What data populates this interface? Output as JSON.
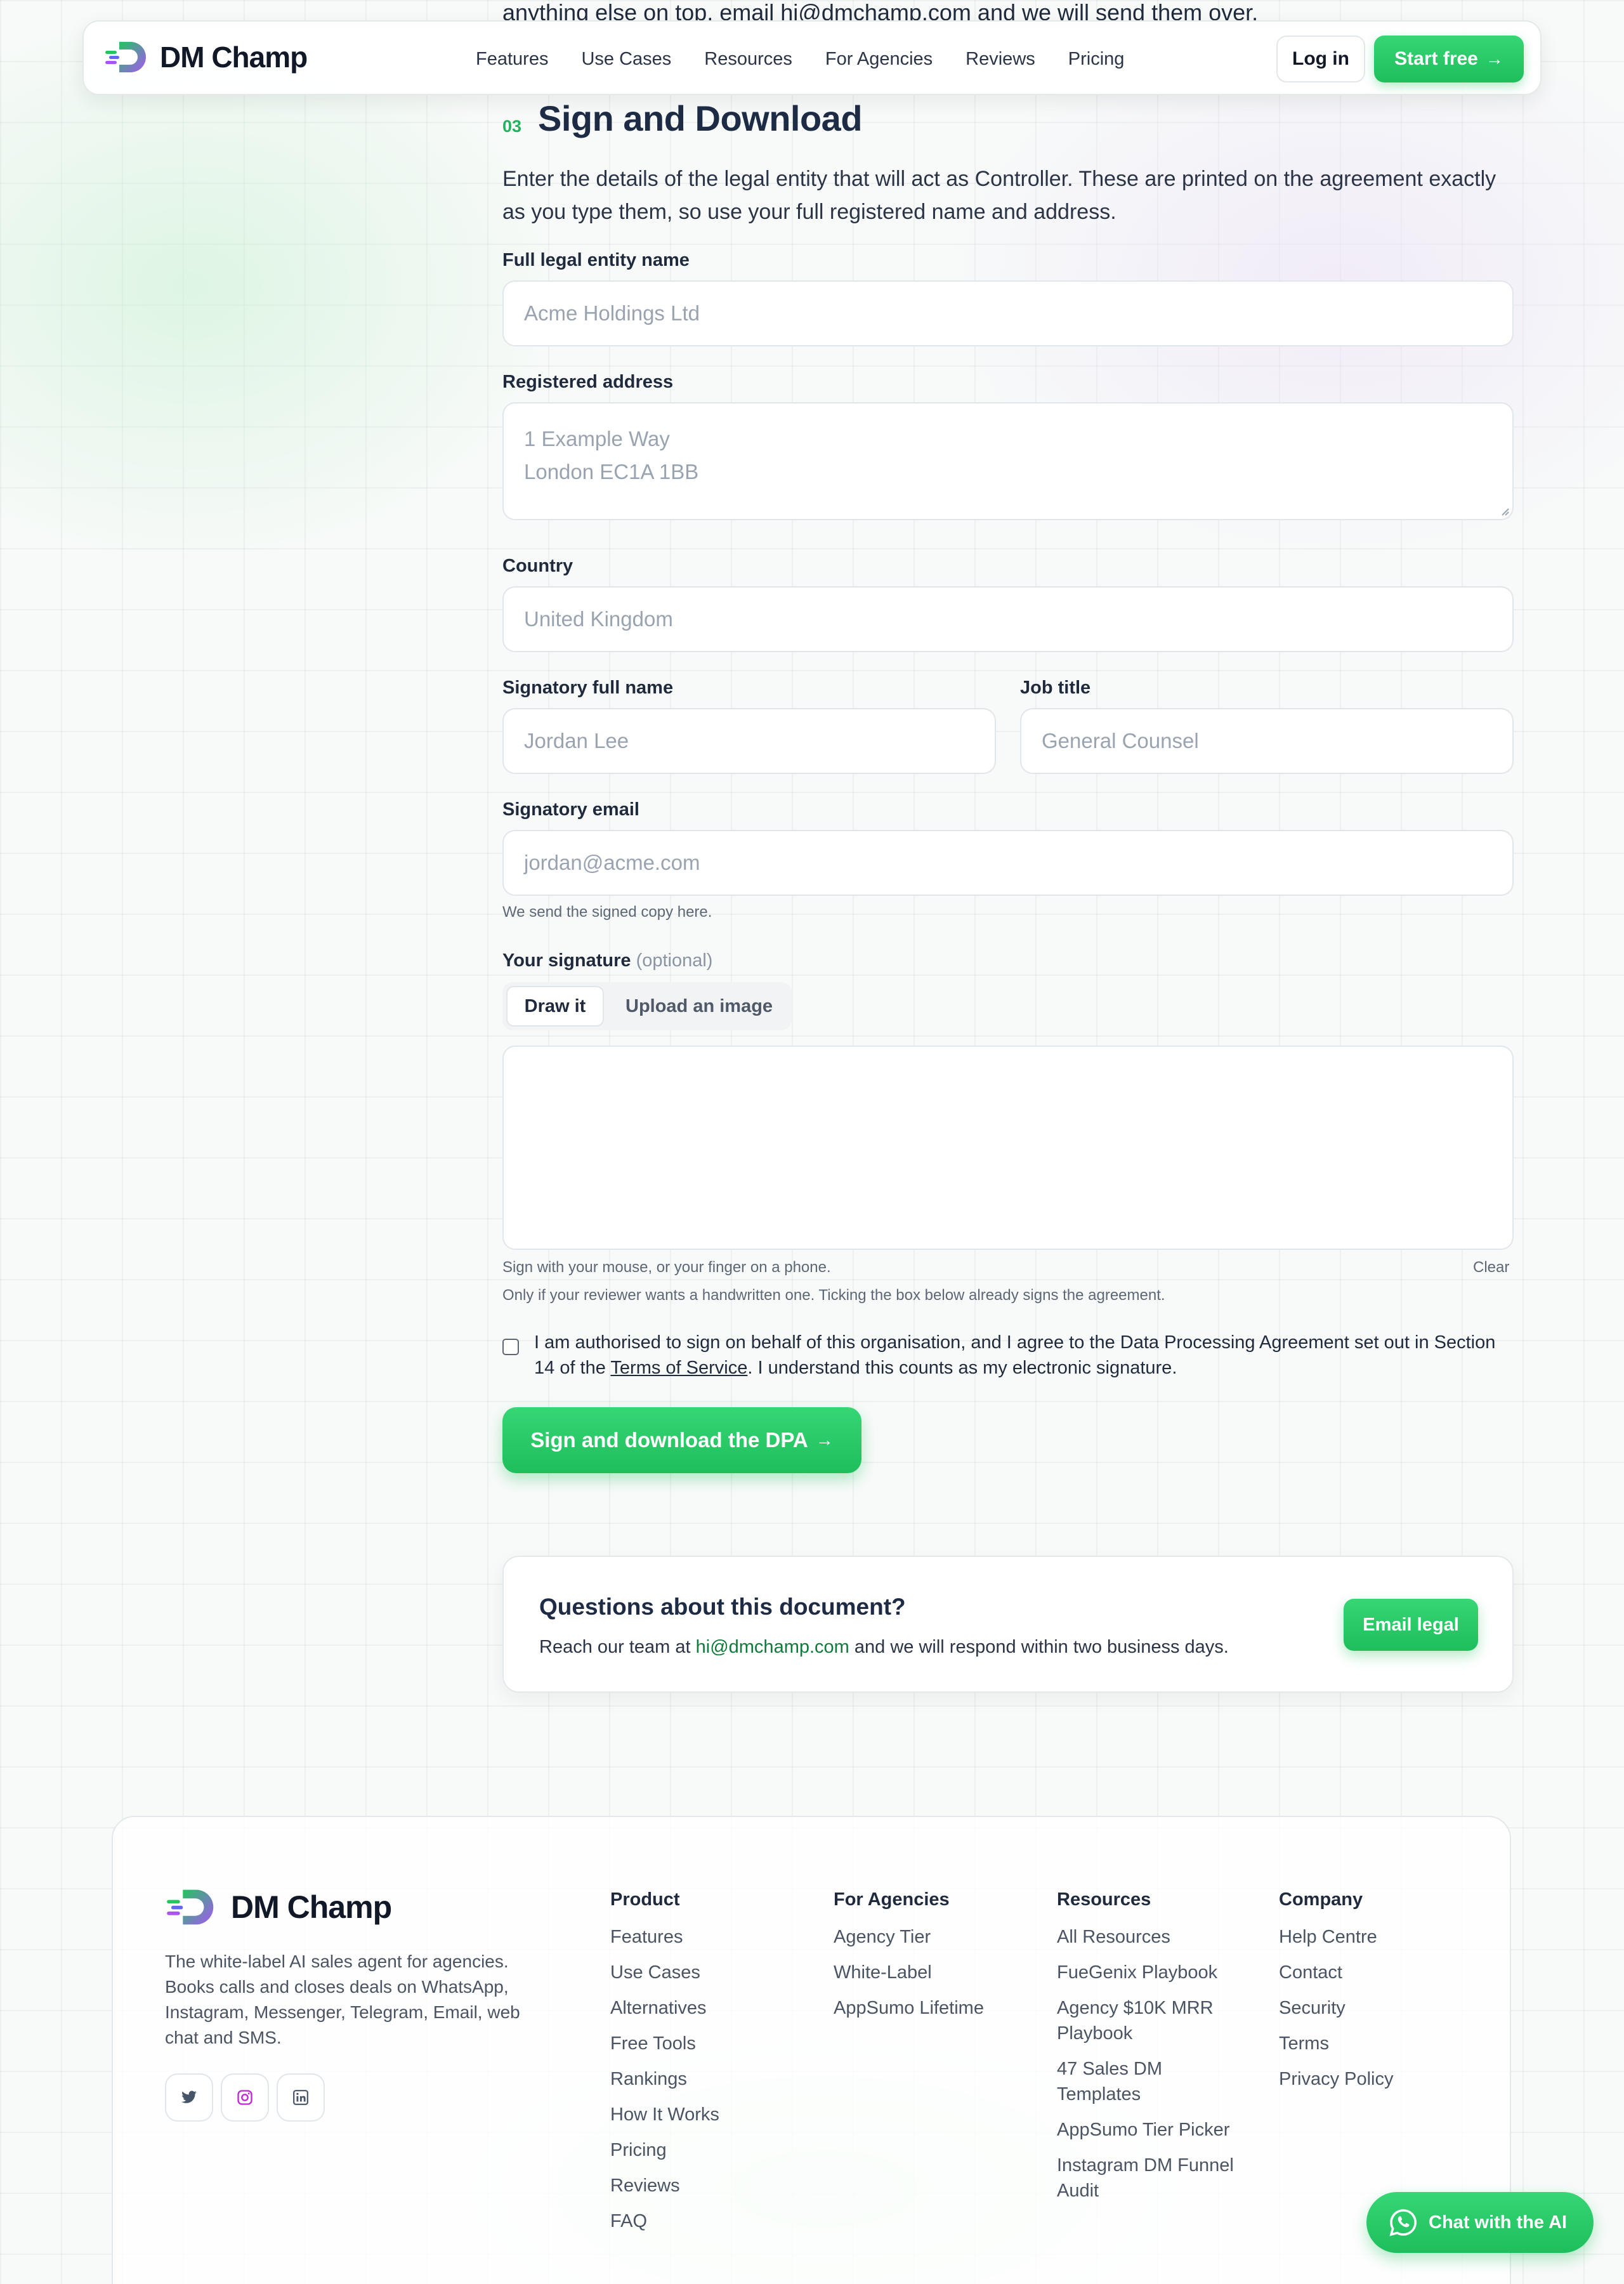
{
  "page": {
    "behind_text": "anything else on top, email hi@dmchamp.com and we will send them over."
  },
  "nav": {
    "brand": "DM Champ",
    "links": [
      "Features",
      "Use Cases",
      "Resources",
      "For Agencies",
      "Reviews",
      "Pricing"
    ],
    "login": "Log in",
    "start": "Start free"
  },
  "section": {
    "number": "03",
    "title": "Sign and Download",
    "intro": "Enter the details of the legal entity that will act as Controller. These are printed on the agreement exactly as you type them, so use your full registered name and address."
  },
  "form": {
    "entity_label": "Full legal entity name",
    "entity_placeholder": "Acme Holdings Ltd",
    "address_label": "Registered address",
    "address_placeholder_line1": "1 Example Way",
    "address_placeholder_line2": "London EC1A 1BB",
    "country_label": "Country",
    "country_placeholder": "United Kingdom",
    "signatory_label": "Signatory full name",
    "signatory_placeholder": "Jordan Lee",
    "job_label": "Job title",
    "job_placeholder": "General Counsel",
    "email_label": "Signatory email",
    "email_placeholder": "jordan@acme.com",
    "email_help": "We send the signed copy here.",
    "signature_label": "Your signature",
    "signature_optional": "(optional)",
    "tab_draw": "Draw it",
    "tab_upload": "Upload an image",
    "sig_help1": "Sign with your mouse, or your finger on a phone.",
    "sig_help2": "Only if your reviewer wants a handwritten one. Ticking the box below already signs the agreement.",
    "clear": "Clear",
    "consent_part1": "I am authorised to sign on behalf of this organisation, and I agree to the Data Processing Agreement set out in Section 14 of the ",
    "consent_link": "Terms of Service",
    "consent_part2": ". I understand this counts as my electronic signature.",
    "submit": "Sign and download the DPA"
  },
  "questions": {
    "title": "Questions about this document?",
    "text_before": "Reach our team at ",
    "email": "hi@dmchamp.com",
    "text_after": " and we will respond within two business days.",
    "button": "Email legal"
  },
  "footer": {
    "brand": "DM Champ",
    "description": "The white-label AI sales agent for agencies. Books calls and closes deals on WhatsApp, Instagram, Messenger, Telegram, Email, web chat and SMS.",
    "socials": [
      "twitter-icon",
      "instagram-icon",
      "linkedin-icon"
    ],
    "columns": [
      {
        "heading": "Product",
        "items": [
          "Features",
          "Use Cases",
          "Alternatives",
          "Free Tools",
          "Rankings",
          "How It Works",
          "Pricing",
          "Reviews",
          "FAQ"
        ]
      },
      {
        "heading": "For Agencies",
        "items": [
          "Agency Tier",
          "White-Label",
          "AppSumo Lifetime"
        ]
      },
      {
        "heading": "Resources",
        "items": [
          "All Resources",
          "FueGenix Playbook",
          "Agency $10K MRR Playbook",
          "47 Sales DM Templates",
          "AppSumo Tier Picker",
          "Instagram DM Funnel Audit"
        ]
      },
      {
        "heading": "Company",
        "items": [
          "Help Centre",
          "Contact",
          "Security",
          "Terms",
          "Privacy Policy"
        ]
      }
    ]
  },
  "chat": {
    "label": "Chat with the AI"
  },
  "colors": {
    "accent": "#22c55e",
    "text": "#1f2a3d",
    "link_green": "#0f7a3a"
  }
}
